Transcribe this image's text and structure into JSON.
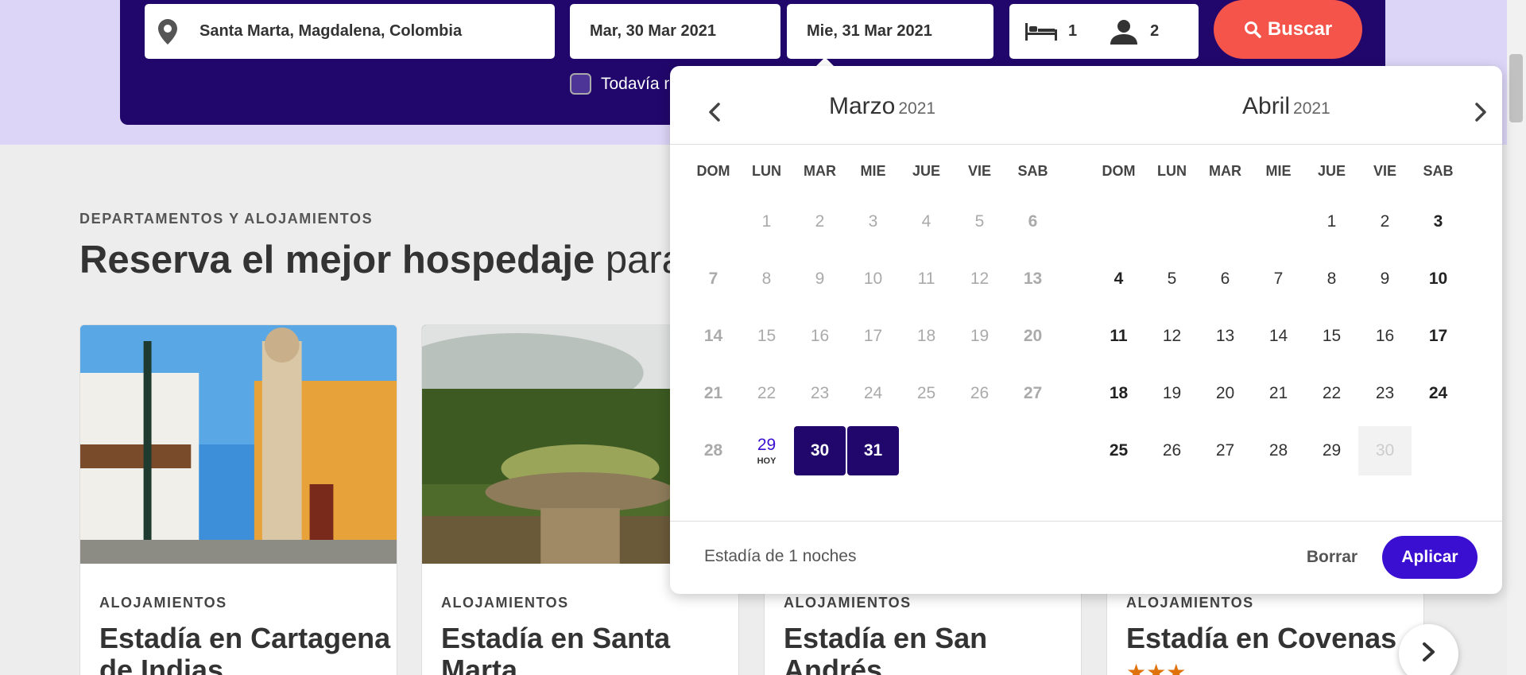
{
  "search": {
    "destination": "Santa Marta, Magdalena, Colombia",
    "checkin": "Mar, 30 Mar 2021",
    "checkout": "Mie, 31 Mar 2021",
    "beds": "1",
    "guests": "2",
    "search_button": "Buscar",
    "unsure_label": "Todavía no sé las fechas"
  },
  "section": {
    "kicker": "DEPARTAMENTOS Y ALOJAMIENTOS",
    "title_strong": "Reserva el mejor hospedaje",
    "title_rest": " para tu viaje"
  },
  "cards": [
    {
      "label": "ALOJAMIENTOS",
      "title": "Estadía en Cartagena de Indias"
    },
    {
      "label": "ALOJAMIENTOS",
      "title": "Estadía en Santa Marta"
    },
    {
      "label": "ALOJAMIENTOS",
      "title": "Estadía en San Andrés"
    },
    {
      "label": "ALOJAMIENTOS",
      "title": "Estadía en Covenas",
      "stars": "★★★"
    }
  ],
  "datepicker": {
    "left_month": "Marzo",
    "left_year": "2021",
    "right_month": "Abril",
    "right_year": "2021",
    "weekdays": [
      "DOM",
      "LUN",
      "MAR",
      "MIE",
      "JUE",
      "VIE",
      "SAB"
    ],
    "march_days": [
      "",
      "1",
      "2",
      "3",
      "4",
      "5",
      "6",
      "7",
      "8",
      "9",
      "10",
      "11",
      "12",
      "13",
      "14",
      "15",
      "16",
      "17",
      "18",
      "19",
      "20",
      "21",
      "22",
      "23",
      "24",
      "25",
      "26",
      "27",
      "28",
      "29",
      "30",
      "31",
      "",
      "",
      ""
    ],
    "april_days": [
      "",
      "",
      "",
      "",
      "1",
      "2",
      "3",
      "4",
      "5",
      "6",
      "7",
      "8",
      "9",
      "10",
      "11",
      "12",
      "13",
      "14",
      "15",
      "16",
      "17",
      "18",
      "19",
      "20",
      "21",
      "22",
      "23",
      "24",
      "25",
      "26",
      "27",
      "28",
      "29",
      "30",
      ""
    ],
    "today_label": "HOY",
    "today_day": "29",
    "selected_days": [
      "30",
      "31"
    ],
    "disabled_april_day": "30",
    "stay_text": "Estadía de 1 noches",
    "clear_button": "Borrar",
    "apply_button": "Aplicar"
  },
  "colors": {
    "brand_dark": "#21076b",
    "accent_search": "#f5544b",
    "accent_apply": "#3a0fd1",
    "hero_bg": "#dcd5f7"
  }
}
